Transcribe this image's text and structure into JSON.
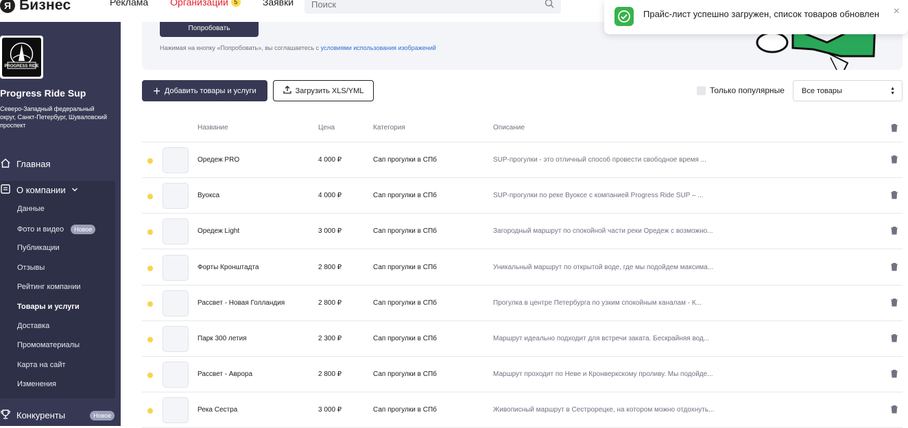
{
  "brand": {
    "mark": "Я",
    "name": "Бизнес"
  },
  "topnav": {
    "ads": "Реклама",
    "orgs": "Организации",
    "orgs_count": "5",
    "requests": "Заявки",
    "search_placeholder": "Поиск"
  },
  "toast": {
    "message": "Прайс-лист успешно загружен, список товаров обновлен",
    "close": "×"
  },
  "sidebar": {
    "company_name": "Progress Ride Sup",
    "company_address": "Северо-Западный федеральный округ, Санкт-Петербург, Шуваловский проспект",
    "logo_text": "PROGRESS RIDE",
    "home": "Главная",
    "about": "О компании",
    "items": [
      {
        "label": "Данные"
      },
      {
        "label": "Фото и видео",
        "badge": "Новое"
      },
      {
        "label": "Публикации"
      },
      {
        "label": "Отзывы"
      },
      {
        "label": "Рейтинг компании"
      },
      {
        "label": "Товары и услуги"
      },
      {
        "label": "Доставка"
      },
      {
        "label": "Промоматериалы"
      },
      {
        "label": "Карта на сайт"
      },
      {
        "label": "Изменения"
      }
    ],
    "competitors": "Конкуренты",
    "competitors_badge": "Новое"
  },
  "banner": {
    "try_button": "Попробовать",
    "terms_prefix": "Нажимая на кнопку «Попробовать», вы соглашаетесь с ",
    "terms_link": "условиями использования изображений"
  },
  "toolbar": {
    "add_button": "Добавить товары и услуги",
    "upload_button": "Загрузить XLS/YML",
    "popular_label": "Только популярные",
    "filter_value": "Все товары"
  },
  "table": {
    "headers": {
      "name": "Название",
      "price": "Цена",
      "category": "Категория",
      "description": "Описание"
    },
    "rows": [
      {
        "name": "Оредеж PRO",
        "price": "4 000 ₽",
        "category": "Сап прогулки в СПб",
        "description": "SUP-прогулки - это отличный способ провести свободное время ..."
      },
      {
        "name": "Вуокса",
        "price": "4 000 ₽",
        "category": "Сап прогулки в СПб",
        "description": "SUP-прогулки по реке Вуоксе с компанией Progress Ride SUP – ..."
      },
      {
        "name": "Оредеж Light",
        "price": "3 000 ₽",
        "category": "Сап прогулки в СПб",
        "description": "Загородный маршрут по спокойной части реки Оредеж с возможно..."
      },
      {
        "name": "Форты Кронштадта",
        "price": "2 800 ₽",
        "category": "Сап прогулки в СПб",
        "description": "Уникальный маршрут по открытой воде, где мы подойдем максима..."
      },
      {
        "name": "Рассвет - Новая Голландия",
        "price": "2 800 ₽",
        "category": "Сап прогулки в СПб",
        "description": "Прогулка в центре Петербурга по узким спокойным каналам - К..."
      },
      {
        "name": "Парк 300 летия",
        "price": "2 300 ₽",
        "category": "Сап прогулки в СПб",
        "description": "Маршрут идеально подходит для встречи заката. Бескрайняя вод..."
      },
      {
        "name": "Рассвет - Аврора",
        "price": "2 800 ₽",
        "category": "Сап прогулки в СПб",
        "description": "Маршрут проходит по Неве и Кронверкскому проливу. Мы подойде..."
      },
      {
        "name": "Река Сестра",
        "price": "3 000 ₽",
        "category": "Сап прогулки в СПб",
        "description": "Живописный маршрут в Сестрорецке, на котором можно отдохнуть..."
      }
    ]
  },
  "colors": {
    "sidebar": "#373954",
    "accent_red": "#e4202a",
    "status_dot": "#f7d44a",
    "success": "#37b34a"
  }
}
